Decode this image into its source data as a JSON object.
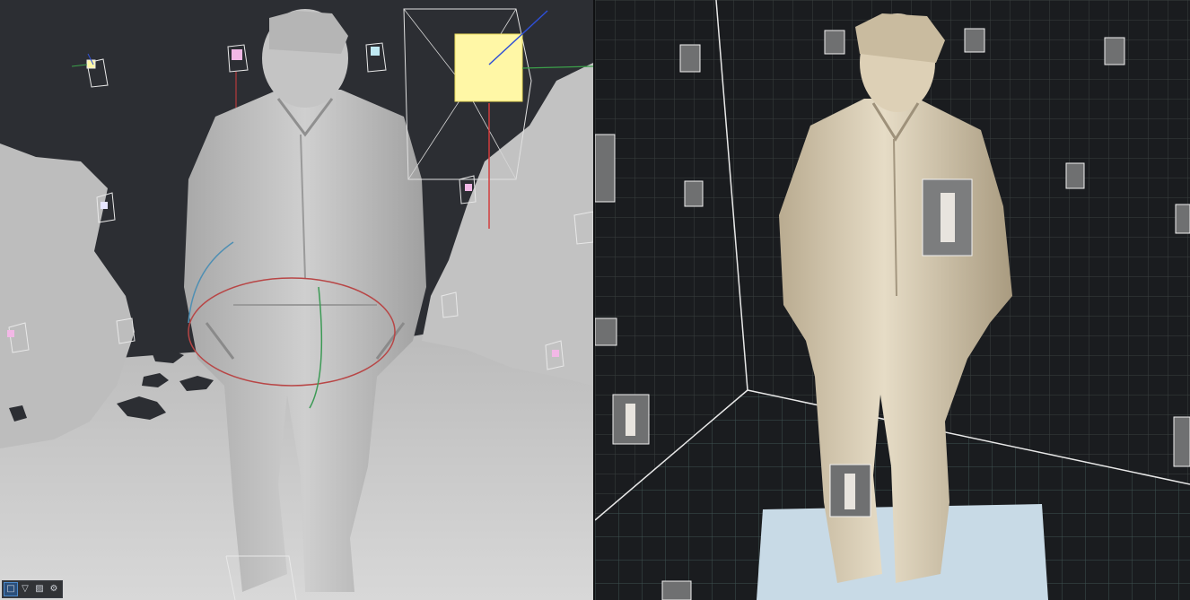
{
  "app": {
    "left_viewport": {
      "name": "mesh-reconstruction-viewport",
      "colors": {
        "background": "#2c2e33",
        "mesh": "#c9c9c9",
        "mesh_shadow": "#9a9a9a",
        "selected_camera": "#fff7a6",
        "axis_x": "#d23c3c",
        "axis_y": "#3ca04a",
        "axis_z": "#2e4fd6"
      }
    },
    "right_viewport": {
      "name": "textured-model-viewport",
      "colors": {
        "background": "#1a1c1f",
        "grid": "#3a4a4a",
        "model": "#d9cdb5",
        "floor": "#c8dae6"
      }
    },
    "toolbar": {
      "buttons": [
        {
          "name": "select-tool",
          "icon": "square-select-icon",
          "glyph": "□",
          "active": true
        },
        {
          "name": "frustum-tool",
          "icon": "triangle-down-icon",
          "glyph": "▽",
          "active": false
        },
        {
          "name": "texture-tool",
          "icon": "hatch-icon",
          "glyph": "▨",
          "active": false
        },
        {
          "name": "settings-tool",
          "icon": "gear-icon",
          "glyph": "⚙",
          "active": false
        }
      ]
    }
  }
}
